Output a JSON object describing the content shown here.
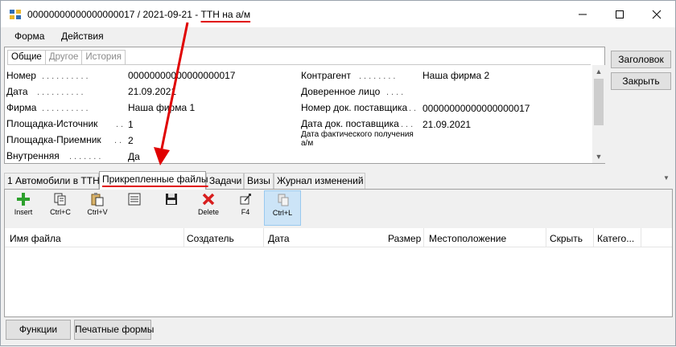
{
  "window": {
    "title_prefix": "00000000000000000017 / 2021-09-21 - ",
    "title_highlight": "ТТН на а/м",
    "icons": {
      "app": "app-icon",
      "minimize": "minimize-icon",
      "maximize": "maximize-icon",
      "close": "close-icon"
    }
  },
  "menu": {
    "items": [
      "Форма",
      "Действия"
    ]
  },
  "info": {
    "subtabs": [
      "Общие",
      "Другое",
      "История"
    ],
    "left_fields": [
      {
        "label": "Номер",
        "value": "00000000000000000017"
      },
      {
        "label": "Дата",
        "value": "21.09.2021"
      },
      {
        "label": "Фирма",
        "value": "Наша фирма 1"
      },
      {
        "label": "Площадка-Источник",
        "value": "1"
      },
      {
        "label": "Площадка-Приемник",
        "value": "2"
      },
      {
        "label": "Внутренняя",
        "value": "Да"
      }
    ],
    "right_fields": [
      {
        "label": "Контрагент",
        "value": "Наша фирма 2"
      },
      {
        "label": "Доверенное лицо",
        "value": ""
      },
      {
        "label": "Номер док. поставщика",
        "value": "00000000000000000017"
      },
      {
        "label": "Дата док. поставщика",
        "value": "21.09.2021"
      }
    ],
    "small_label": "Дата фактического получения а/м"
  },
  "side_buttons": {
    "header": "Заголовок",
    "close": "Закрыть"
  },
  "tabs": [
    {
      "label": "1 Автомобили в ТТН"
    },
    {
      "label": "Прикрепленные файлы",
      "active": true
    },
    {
      "label": "Задачи"
    },
    {
      "label": "Визы"
    },
    {
      "label": "Журнал изменений"
    }
  ],
  "toolbar": [
    {
      "label": "Insert",
      "icon": "plus-icon"
    },
    {
      "label": "Ctrl+C",
      "icon": "copy-icon"
    },
    {
      "label": "Ctrl+V",
      "icon": "paste-icon"
    },
    {
      "label": "",
      "icon": "list-icon"
    },
    {
      "label": "",
      "icon": "save-icon"
    },
    {
      "label": "Delete",
      "icon": "delete-icon"
    },
    {
      "label": "F4",
      "icon": "edit-icon"
    },
    {
      "label": "Ctrl+L",
      "icon": "link-icon",
      "active": true
    }
  ],
  "grid": {
    "columns": [
      "Имя файла",
      "Создатель",
      "Дата",
      "Размер",
      "Местоположение",
      "Скрыть",
      "Катего..."
    ]
  },
  "bottom_buttons": [
    "Функции",
    "Печатные формы"
  ],
  "colors": {
    "annotation": "#e00000",
    "selected_tool": "#cce4f7"
  }
}
